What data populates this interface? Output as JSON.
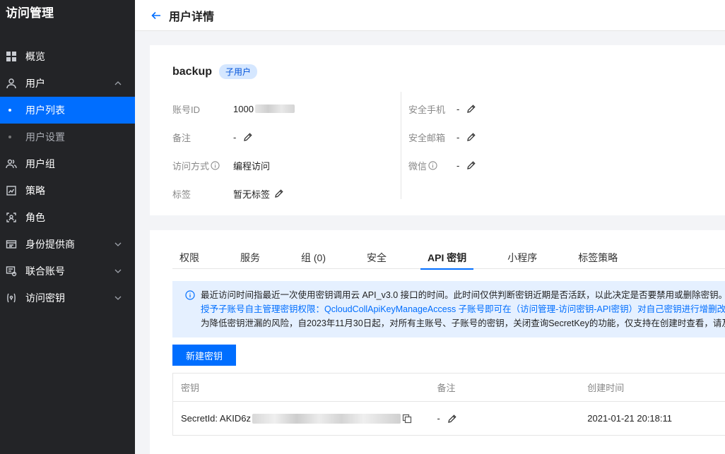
{
  "sidebar": {
    "brand": "访问管理",
    "items": [
      {
        "label": "概览"
      },
      {
        "label": "用户"
      },
      {
        "label": "用户列表"
      },
      {
        "label": "用户设置"
      },
      {
        "label": "用户组"
      },
      {
        "label": "策略"
      },
      {
        "label": "角色"
      },
      {
        "label": "身份提供商"
      },
      {
        "label": "联合账号"
      },
      {
        "label": "访问密钥"
      }
    ]
  },
  "header": {
    "title": "用户详情"
  },
  "user": {
    "name": "backup",
    "type_tag": "子用户",
    "fields_left": [
      {
        "label": "账号ID",
        "value": "1000"
      },
      {
        "label": "备注",
        "value": "-"
      },
      {
        "label": "访问方式",
        "value": "编程访问"
      },
      {
        "label": "标签",
        "value": "暂无标签"
      }
    ],
    "fields_right": [
      {
        "label": "安全手机",
        "value": "-"
      },
      {
        "label": "安全邮箱",
        "value": "-"
      },
      {
        "label": "微信",
        "value": "-"
      }
    ]
  },
  "tabs": [
    "权限",
    "服务",
    "组 (0)",
    "安全",
    "API 密钥",
    "小程序",
    "标签策略"
  ],
  "notice": {
    "line1": "最近访问时间指最近一次使用密钥调用云 API_v3.0 接口的时间。此时间仅供判断密钥近期是否活跃，以此决定是否要禁用或删除密钥。",
    "line2": "授予子账号自主管理密钥权限：QcloudCollApiKeyManageAccess 子账号即可在（访问管理-访问密钥-API密钥）对自己密钥进行增删改查。",
    "line3": "为降低密钥泄漏的风险，自2023年11月30日起，对所有主账号、子账号的密钥，关闭查询SecretKey的功能，仅支持在创建时查看，请及时保"
  },
  "new_key_button": "新建密钥",
  "table": {
    "headers": [
      "密钥",
      "备注",
      "创建时间"
    ],
    "rows": [
      {
        "secret_id_prefix": "SecretId: AKID6z",
        "remark": "-",
        "created": "2021-01-21 20:18:11"
      }
    ]
  }
}
